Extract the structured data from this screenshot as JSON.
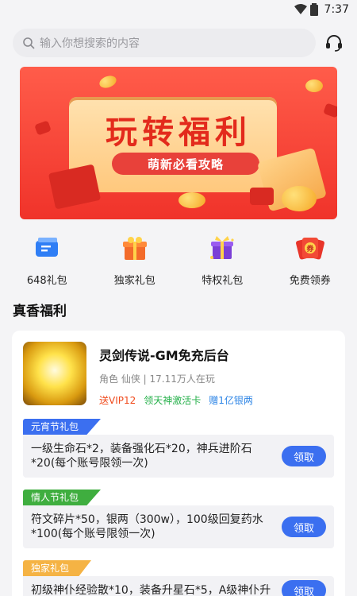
{
  "status_bar": {
    "time": "7:37"
  },
  "search": {
    "placeholder": "输入你想搜索的内容"
  },
  "banner": {
    "title": "玩转福利",
    "subtitle": "萌新必看攻略"
  },
  "quick_entries": [
    {
      "label": "648礼包",
      "icon": "ticket-icon"
    },
    {
      "label": "独家礼包",
      "icon": "gift-box-icon"
    },
    {
      "label": "特权礼包",
      "icon": "purple-gift-icon"
    },
    {
      "label": "免费领券",
      "icon": "coupon-icon"
    }
  ],
  "section_title": "真香福利",
  "game": {
    "name": "灵剑传说-GM免充后台",
    "meta": "角色 仙侠 | 17.11万人在玩",
    "tags": [
      "送VIP12",
      "领天神激活卡",
      "赠1亿银两"
    ]
  },
  "gifts": [
    {
      "tag": "元宵节礼包",
      "tag_color": "#3b6ff0",
      "desc": "一级生命石*2，装备强化石*20，神兵进阶石*20(每个账号限领一次)",
      "button": "领取"
    },
    {
      "tag": "情人节礼包",
      "tag_color": "#3fae3f",
      "desc": "符文碎片*50，银两（300w），100级回复药水*100(每个账号限领一次)",
      "button": "领取"
    },
    {
      "tag": "独家礼包",
      "tag_color": "#f5b344",
      "desc": "初级神仆经验散*10，装备升星石*5，A级神仆升",
      "button": "领取"
    }
  ]
}
